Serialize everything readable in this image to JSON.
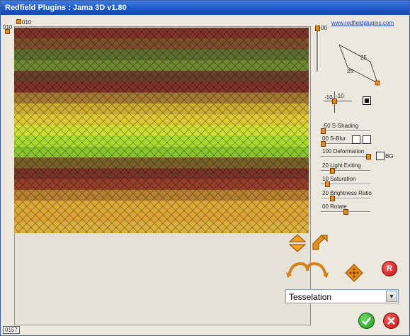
{
  "window": {
    "title": "Redfield Plugins : Jama 3D  v1.80"
  },
  "link": {
    "text": "www.redfieldplugins.com"
  },
  "preview": {
    "x_origin_label": "010",
    "y_origin_label": "010",
    "tile_rows": [
      "#6e1c12",
      "#6e3a14",
      "#4a5e18",
      "#5e7a1a",
      "#5a2a10",
      "#6e1a12",
      "#9a6a1a",
      "#c6a21a",
      "#d8c21e",
      "#c9d81e",
      "#9ed818",
      "#7fc018",
      "#6a5014",
      "#6a1e12",
      "#8a2a14",
      "#b0721a",
      "#d8a020",
      "#d99a20",
      "#d5a628"
    ]
  },
  "right_panel": {
    "top_value_label": "00",
    "light_edge_1": "25",
    "light_edge_2": "25",
    "offset_x_label": "-10",
    "offset_y_label": "-10",
    "shade_color": "#1a0d0a",
    "bg_color": "#ffffff"
  },
  "sliders": [
    {
      "label": "-50  S-Shading",
      "fraction": 0.0
    },
    {
      "label": "00  S-Blur",
      "fraction": 0.0
    },
    {
      "label": "100  Deformation",
      "fraction": 1.0
    },
    {
      "label": "20   Light Exiting",
      "fraction": 0.2
    },
    {
      "label": "10   Saturation",
      "fraction": 0.1
    },
    {
      "label": "20   Brightness Ratio",
      "fraction": 0.2
    },
    {
      "label": "00  Rotate",
      "fraction": 0.5
    }
  ],
  "bg_label": "BG",
  "dropdown": {
    "value": "Tesselation"
  },
  "status": {
    "value": "0157"
  },
  "buttons": {
    "reset": "R"
  }
}
